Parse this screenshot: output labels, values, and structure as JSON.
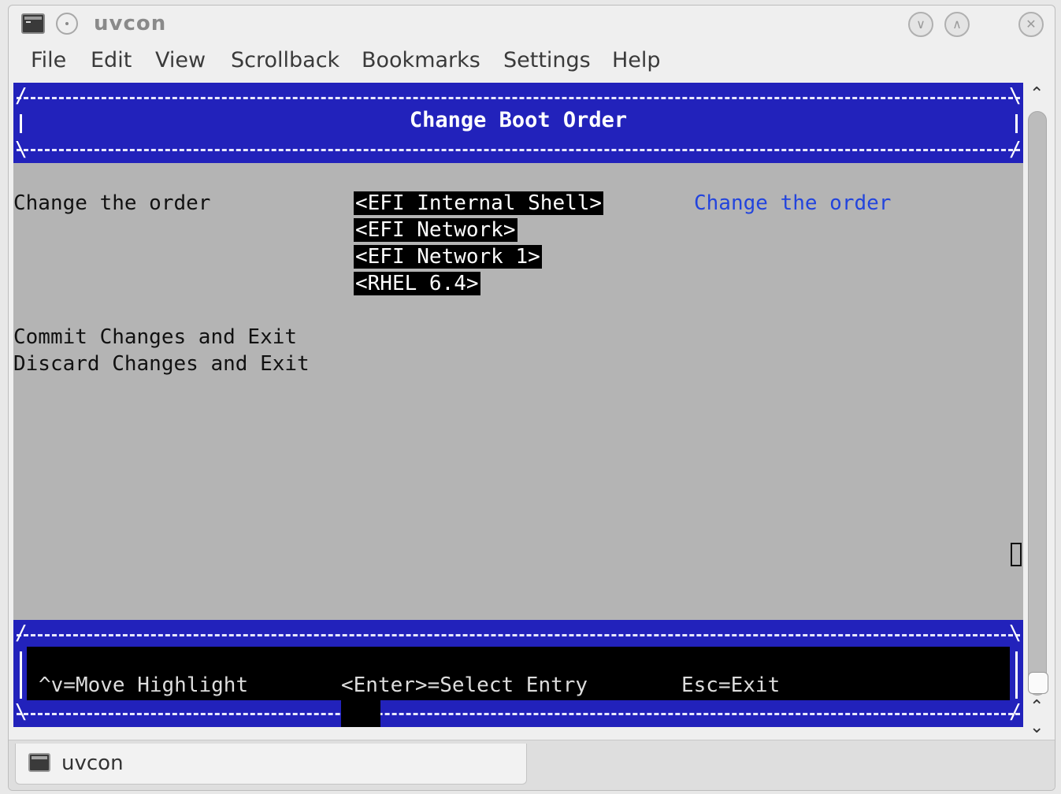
{
  "window": {
    "title": "uvcon"
  },
  "menu": [
    "File",
    "Edit",
    "View",
    "Scrollback",
    "Bookmarks",
    "Settings",
    "Help"
  ],
  "terminal": {
    "header_title": "Change Boot Order",
    "left_label": "Change the order",
    "boot_entries": [
      "<EFI Internal Shell>",
      "<EFI Network>",
      "<EFI Network 1>",
      "<RHEL 6.4>"
    ],
    "help_text": "Change the order",
    "commit": "Commit Changes and Exit",
    "discard": "Discard Changes and Exit",
    "footer": {
      "move": "^v=Move Highlight",
      "select": "<Enter>=Select Entry",
      "exit": "Esc=Exit"
    }
  },
  "tabs": [
    {
      "label": "uvcon"
    }
  ],
  "colors": {
    "band": "#2222bb",
    "terminal_bg": "#b4b4b4",
    "help_text": "#2244dd",
    "highlight": "#000000"
  },
  "icons": [
    "terminal-icon",
    "pin-icon",
    "minimize-icon",
    "maximize-icon",
    "close-icon",
    "scroll-up-icon",
    "scroll-down-icon"
  ]
}
